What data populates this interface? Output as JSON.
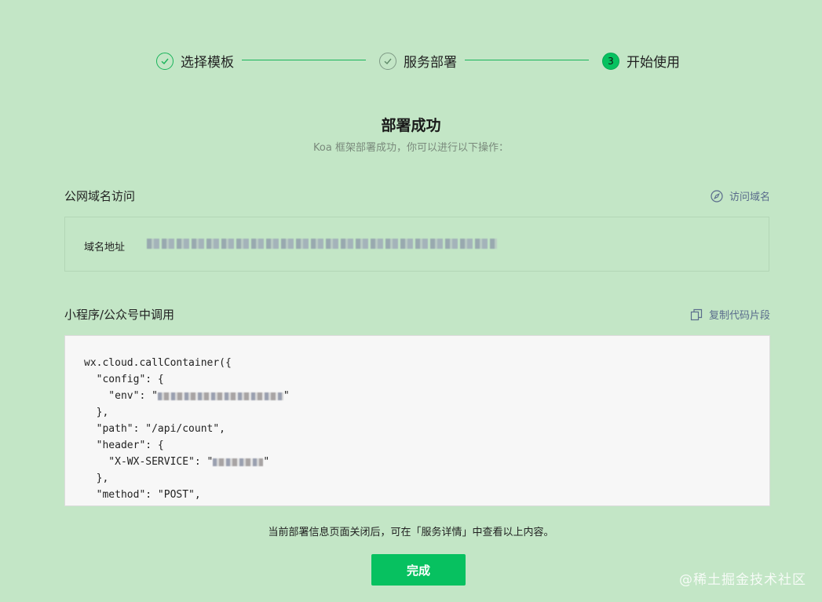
{
  "steps": [
    {
      "label": "选择模板",
      "status": "done"
    },
    {
      "label": "服务部署",
      "status": "done"
    },
    {
      "label": "开始使用",
      "status": "active",
      "number": "3"
    }
  ],
  "header": {
    "title": "部署成功",
    "subtitle": "Koa 框架部署成功，你可以进行以下操作："
  },
  "domain_section": {
    "title": "公网域名访问",
    "action_label": "访问域名",
    "field_label": "域名地址"
  },
  "code_section": {
    "title": "小程序/公众号中调用",
    "action_label": "复制代码片段",
    "lines": [
      "wx.cloud.callContainer({",
      "  \"config\": {",
      "    \"env\": \"",
      "  },",
      "  \"path\": \"/api/count\",",
      "  \"header\": {",
      "    \"X-WX-SERVICE\": \"",
      "  },",
      "  \"method\": \"POST\","
    ]
  },
  "note": "当前部署信息页面关闭后，可在「服务详情」中查看以上内容。",
  "done_button": "完成",
  "watermark": "@稀土掘金技术社区",
  "colors": {
    "accent": "#07c160",
    "background": "#c3e6c6"
  }
}
